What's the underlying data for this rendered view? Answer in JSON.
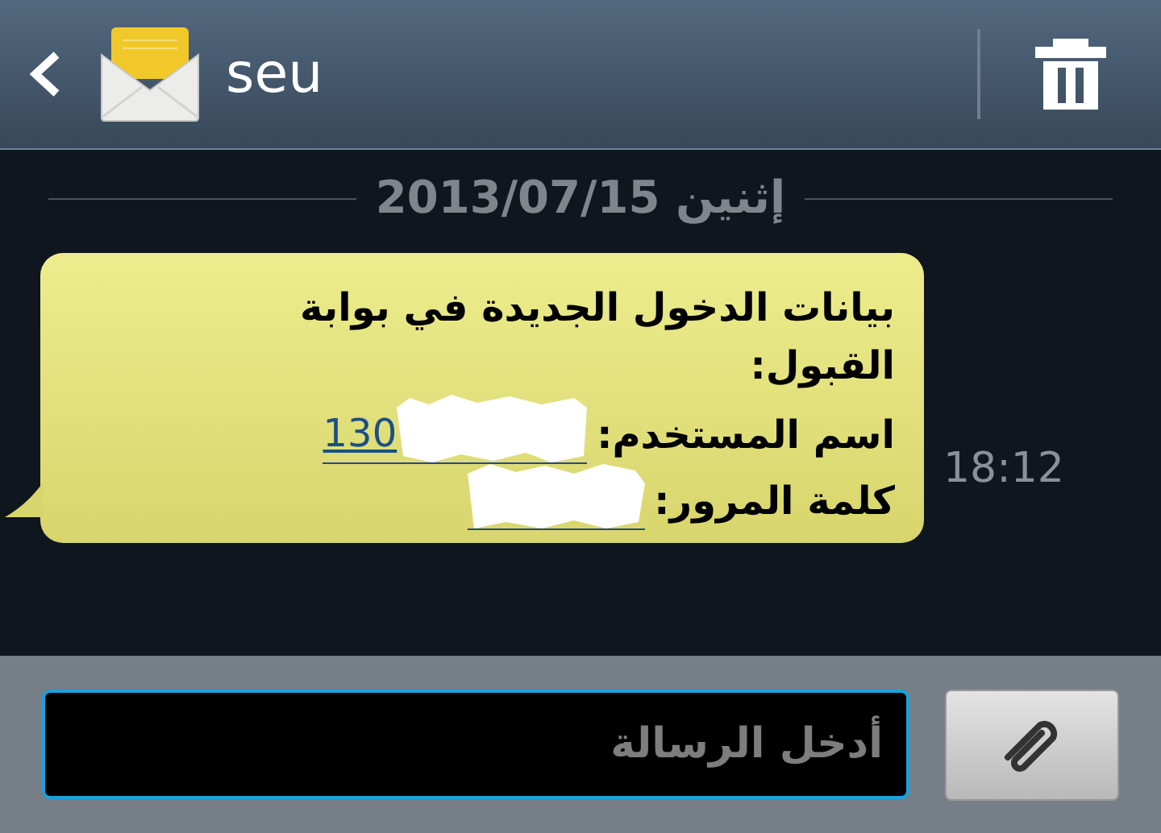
{
  "header": {
    "contact": "seu"
  },
  "date_divider": "إثنين 2013/07/15",
  "message": {
    "title": "بيانات الدخول الجديدة في بوابة القبول:",
    "username_label": "اسم المستخدم:",
    "username_value": "130",
    "password_label": "كلمة المرور:",
    "time": "18:12"
  },
  "composer": {
    "placeholder": "أدخل الرسالة"
  }
}
